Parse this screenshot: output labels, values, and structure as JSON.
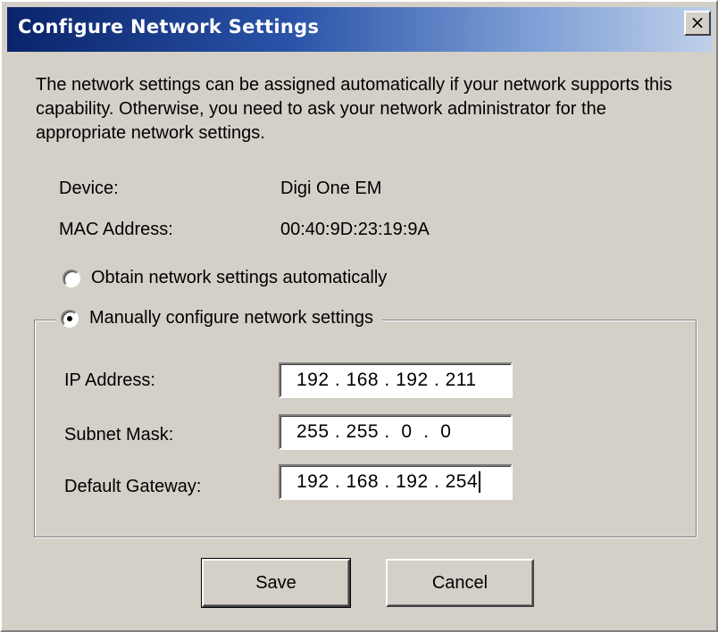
{
  "window": {
    "title": "Configure Network Settings",
    "close_glyph": "×"
  },
  "description": "The network settings can be assigned automatically if your network supports this capability. Otherwise, you need to ask your network administrator for the appropriate network settings.",
  "device": {
    "label": "Device:",
    "value": "Digi One EM"
  },
  "mac": {
    "label": "MAC Address:",
    "value": "00:40:9D:23:19:9A"
  },
  "options": {
    "auto": {
      "label": "Obtain network settings automatically",
      "selected": false
    },
    "manual": {
      "label": "Manually configure network settings",
      "selected": true
    }
  },
  "fields": {
    "ip": {
      "label": "IP Address:",
      "value": "192 . 168 . 192 . 211"
    },
    "subnet": {
      "label": "Subnet Mask:",
      "value": "255 . 255 .  0  .  0"
    },
    "gateway": {
      "label": "Default Gateway:",
      "value": "192 . 168 . 192 . 254"
    }
  },
  "buttons": {
    "save": "Save",
    "cancel": "Cancel"
  },
  "icons": {
    "close": "close-icon",
    "radio": "radio-button"
  }
}
